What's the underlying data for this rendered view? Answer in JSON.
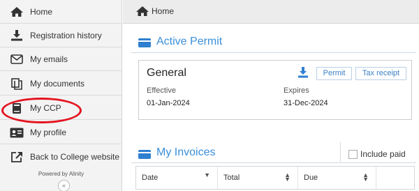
{
  "sidebar": {
    "items": [
      {
        "label": "Home",
        "icon": "home-icon"
      },
      {
        "label": "Registration history",
        "icon": "download-icon"
      },
      {
        "label": "My emails",
        "icon": "envelope-icon"
      },
      {
        "label": "My documents",
        "icon": "documents-icon"
      },
      {
        "label": "My CCP",
        "icon": "book-icon"
      },
      {
        "label": "My profile",
        "icon": "id-card-icon"
      },
      {
        "label": "Back to College website",
        "icon": "external-link-icon"
      }
    ],
    "powered_by": "Powered by Alinity",
    "collapse_glyph": "«"
  },
  "topbar": {
    "label": "Home",
    "icon": "home-icon"
  },
  "active_permit": {
    "title": "Active Permit",
    "name": "General",
    "effective_label": "Effective",
    "effective_value": "01-Jan-2024",
    "expires_label": "Expires",
    "expires_value": "31-Dec-2024",
    "permit_button": "Permit",
    "tax_receipt_button": "Tax receipt"
  },
  "invoices": {
    "title": "My Invoices",
    "include_paid_label": "Include paid",
    "include_paid_checked": false,
    "columns": [
      "Date",
      "Total",
      "Due",
      ""
    ]
  },
  "colors": {
    "accent": "#3a8fd9",
    "highlight": "#e4141f"
  }
}
